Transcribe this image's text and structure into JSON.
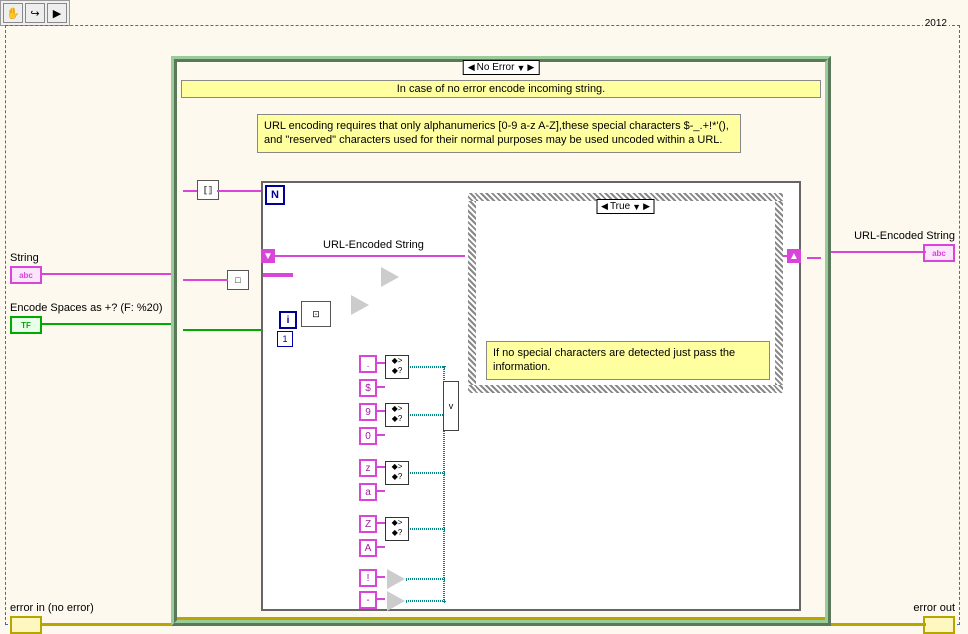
{
  "toolbar": {
    "hand": "✋",
    "arrow": "↪",
    "run": "▶"
  },
  "year": "2012",
  "case": {
    "selector": "No Error",
    "subtitle": "In case of no error encode incoming string.",
    "info": "URL encoding requires that only alphanumerics [0-9 a-z A-Z],these special characters $-_.+!*'(), and \"reserved\" characters used for their normal purposes may be used uncoded within a URL."
  },
  "inputs": {
    "string_label": "String",
    "string_icon": "abc",
    "encode_label": "Encode Spaces as +? (F: %20)",
    "encode_icon": "TF",
    "errin_label": "error in (no error)"
  },
  "outputs": {
    "urlenc_label": "URL-Encoded String",
    "urlenc_icon": "abc",
    "errout_label": "error out"
  },
  "forloop": {
    "n": "N",
    "i": "i",
    "wire_label": "URL-Encoded String"
  },
  "inner_case": {
    "selector": "True",
    "comment": "If no special characters are detected just pass the information."
  },
  "char_consts": [
    ".",
    "$",
    "9",
    "0",
    "z",
    "a",
    "Z",
    "A",
    "!",
    "-"
  ],
  "nodes": {
    "strlen": "⟦⟧",
    "concat": "⊞",
    "subset": "⊡",
    "build": "□□",
    "empty": "□"
  }
}
